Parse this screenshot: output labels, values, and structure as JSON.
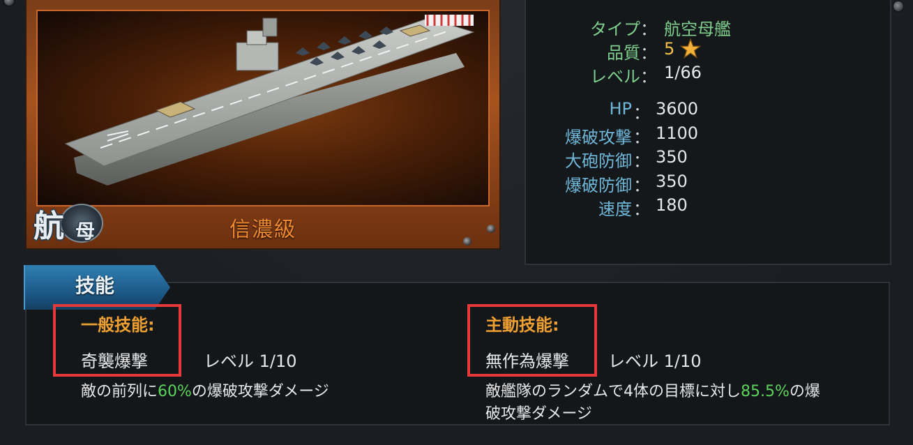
{
  "ship": {
    "class_name": "信濃級",
    "type_badge_main": "航",
    "type_badge_sub": "母"
  },
  "info": {
    "type_label": "タイプ",
    "type_value": "航空母艦",
    "quality_label": "品質",
    "quality_value": "5",
    "level_label": "レベル",
    "level_value": "1/66",
    "separator": "："
  },
  "stats": [
    {
      "label": "HP",
      "value": "3600"
    },
    {
      "label": "爆破攻撃",
      "value": "1100"
    },
    {
      "label": "大砲防御",
      "value": "350"
    },
    {
      "label": "爆破防御",
      "value": "350"
    },
    {
      "label": "速度",
      "value": "180"
    }
  ],
  "skills": {
    "tab_label": "技能",
    "general": {
      "heading": "一般技能:",
      "name": "奇襲爆撃",
      "level": "レベル 1/10",
      "desc_before": "敵の前列に",
      "desc_pct": "60%",
      "desc_after": "の爆破攻撃ダメージ"
    },
    "active": {
      "heading": "主動技能:",
      "name": "無作為爆撃",
      "level": "レベル 1/10",
      "desc_before": "敵艦隊のランダムで4体の目標に対し",
      "desc_pct": "85.5%",
      "desc_after": "の爆",
      "desc_line2": "破攻撃ダメージ"
    }
  },
  "colors": {
    "highlight": "#e53a3a",
    "percent": "#5cd45c",
    "heading": "#f0a030"
  }
}
